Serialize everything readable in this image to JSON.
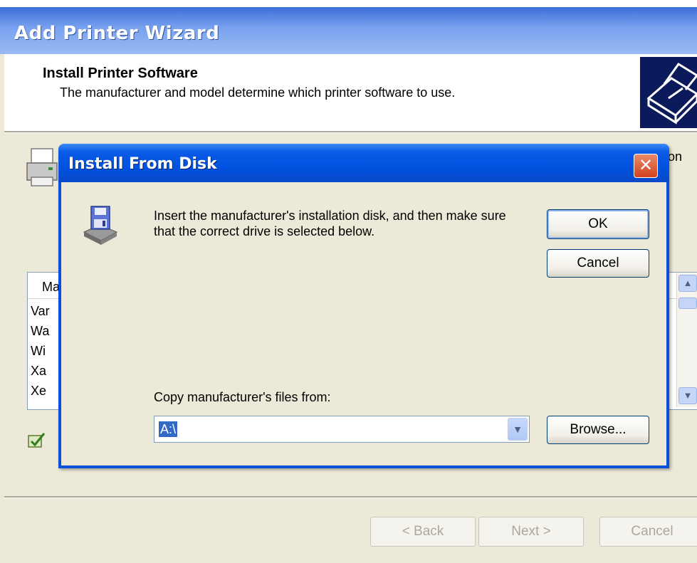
{
  "wizard": {
    "title": "Add Printer Wizard",
    "header_title": "Install Printer Software",
    "header_subtitle": "The manufacturer and model determine which printer software to use.",
    "partial_text": "on",
    "list_header": "Ma",
    "list_items": [
      "Var",
      "Wa",
      "Wi",
      "Xa",
      "Xe"
    ],
    "back_label": "< Back",
    "next_label": "Next >",
    "cancel_label": "Cancel"
  },
  "dialog": {
    "title": "Install From Disk",
    "close_label": "✕",
    "message": "Insert the manufacturer's installation disk, and then make sure that the correct drive is selected below.",
    "ok_label": "OK",
    "cancel_label": "Cancel",
    "copy_label": "Copy manufacturer's files from:",
    "path_value": "A:\\",
    "browse_label": "Browse..."
  },
  "icons": {
    "header": "printer-install-icon",
    "printer": "printer-icon",
    "disk": "floppy-disk-icon",
    "check": "checkmark-icon",
    "close": "close-icon",
    "dropdown": "chevron-down-icon"
  },
  "colors": {
    "titlebar": "#0052e0",
    "dialog_body": "#ece9d8",
    "close_button": "#d2421d",
    "selection": "#316ac5"
  }
}
